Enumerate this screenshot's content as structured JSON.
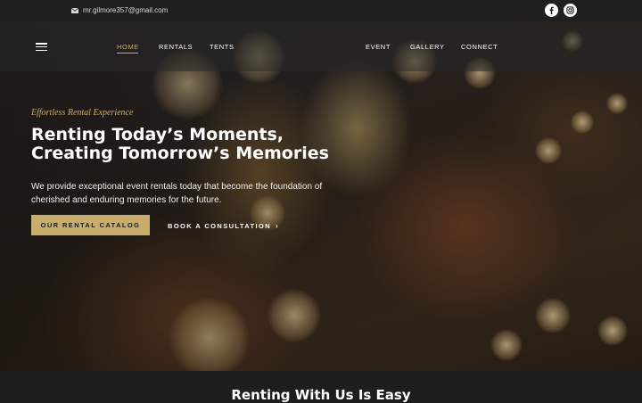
{
  "topbar": {
    "email": "mr.gilmore357@gmail.com",
    "social_icons": [
      "facebook-icon",
      "instagram-icon"
    ]
  },
  "nav": {
    "left": [
      "HOME",
      "RENTALS",
      "TENTS"
    ],
    "right": [
      "EVENT",
      "GALLERY",
      "CONNECT"
    ],
    "active": "HOME"
  },
  "hero": {
    "eyebrow": "Effortless Rental Experience",
    "headline_line1": "Renting Today’s Moments,",
    "headline_line2": "Creating Tomorrow’s Memories",
    "description": "We provide exceptional event rentals today that become the foundation of cherished and enduring memories for the future.",
    "primary_button": "OUR RENTAL CATALOG",
    "secondary_button": "BOOK A CONSULTATION",
    "secondary_chevron": "›"
  },
  "section": {
    "title": "Renting With Us Is Easy"
  },
  "colors": {
    "accent": "#c9ad6b",
    "topbar": "#1f1f1f",
    "footer_bg": "#1e1e1e"
  }
}
